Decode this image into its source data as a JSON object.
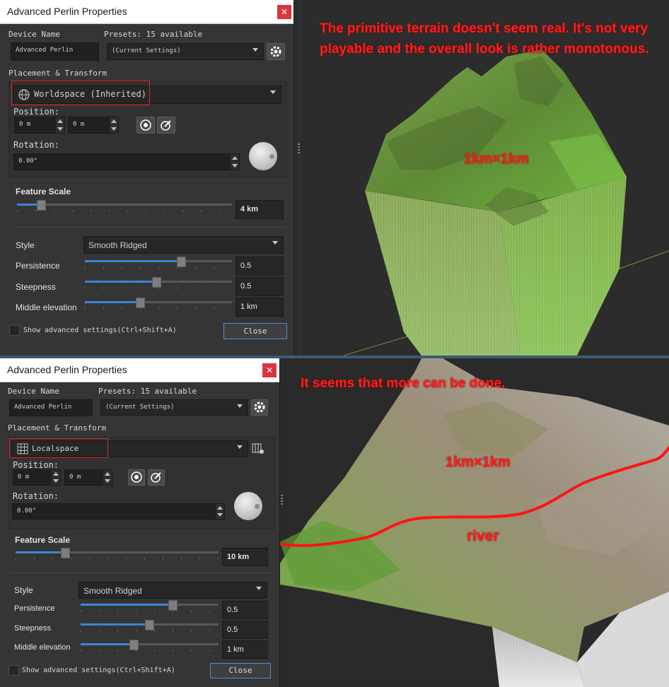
{
  "panels": [
    {
      "dialog": {
        "title": "Advanced Perlin Properties",
        "close_glyph": "✕",
        "device_name_label": "Device Name",
        "device_name_value": "Advanced Perlin",
        "presets_label": "Presets: 15 available",
        "presets_value": "(Current Settings)",
        "placement_label": "Placement & Transform",
        "space_value": "Worldspace (Inherited)",
        "space_icon": "globe-icon",
        "position_label": "Position:",
        "position_x": "0 m",
        "position_y": "0 m",
        "rotation_label": "Rotation:",
        "rotation_value": "0.00°",
        "feature_scale_label": "Feature Scale",
        "feature_scale_value": "4 km",
        "feature_scale_level": 0.11,
        "style_label": "Style",
        "style_value": "Smooth Ridged",
        "persistence_label": "Persistence",
        "persistence_value": "0.5",
        "persistence_level": 0.65,
        "steepness_label": "Steepness",
        "steepness_value": "0.5",
        "steepness_level": 0.48,
        "middle_elevation_label": "Middle elevation",
        "middle_elevation_value": "1 km",
        "middle_elevation_level": 0.37,
        "advanced_label": "Show advanced settings(Ctrl+Shift+A)",
        "close_label": "Close"
      },
      "viewport": {
        "annotation": "The primitive terrain doesn't seem real. It's not very playable and the overall look is rather monotonous.",
        "size_label": "1km×1km"
      }
    },
    {
      "dialog": {
        "title": "Advanced Perlin Properties",
        "close_glyph": "✕",
        "device_name_label": "Device Name",
        "device_name_value": "Advanced Perlin",
        "presets_label": "Presets: 15 available",
        "presets_value": "(Current Settings)",
        "placement_label": "Placement & Transform",
        "space_value": "Localspace",
        "space_icon": "grid-icon",
        "position_label": "Position:",
        "position_x": "0 m",
        "position_y": "0 m",
        "rotation_label": "Rotation:",
        "rotation_value": "0.00°",
        "feature_scale_label": "Feature Scale",
        "feature_scale_value": "10 km",
        "feature_scale_level": 0.24,
        "style_label": "Style",
        "style_value": "Smooth Ridged",
        "persistence_label": "Persistence",
        "persistence_value": "0.5",
        "persistence_level": 0.66,
        "steepness_label": "Steepness",
        "steepness_value": "0.5",
        "steepness_level": 0.49,
        "middle_elevation_label": "Middle elevation",
        "middle_elevation_value": "1 km",
        "middle_elevation_level": 0.38,
        "advanced_label": "Show advanced settings(Ctrl+Shift+A)",
        "close_label": "Close"
      },
      "viewport": {
        "annotation": "It seems that more can be done.",
        "size_label": "1km×1km",
        "river_label": "river"
      }
    }
  ],
  "colors": {
    "annotation": "#ff1e1e",
    "highlight_box": "#e0262a",
    "slider_fill": "#3b86d6",
    "terrain_green": "#6fae3c"
  }
}
